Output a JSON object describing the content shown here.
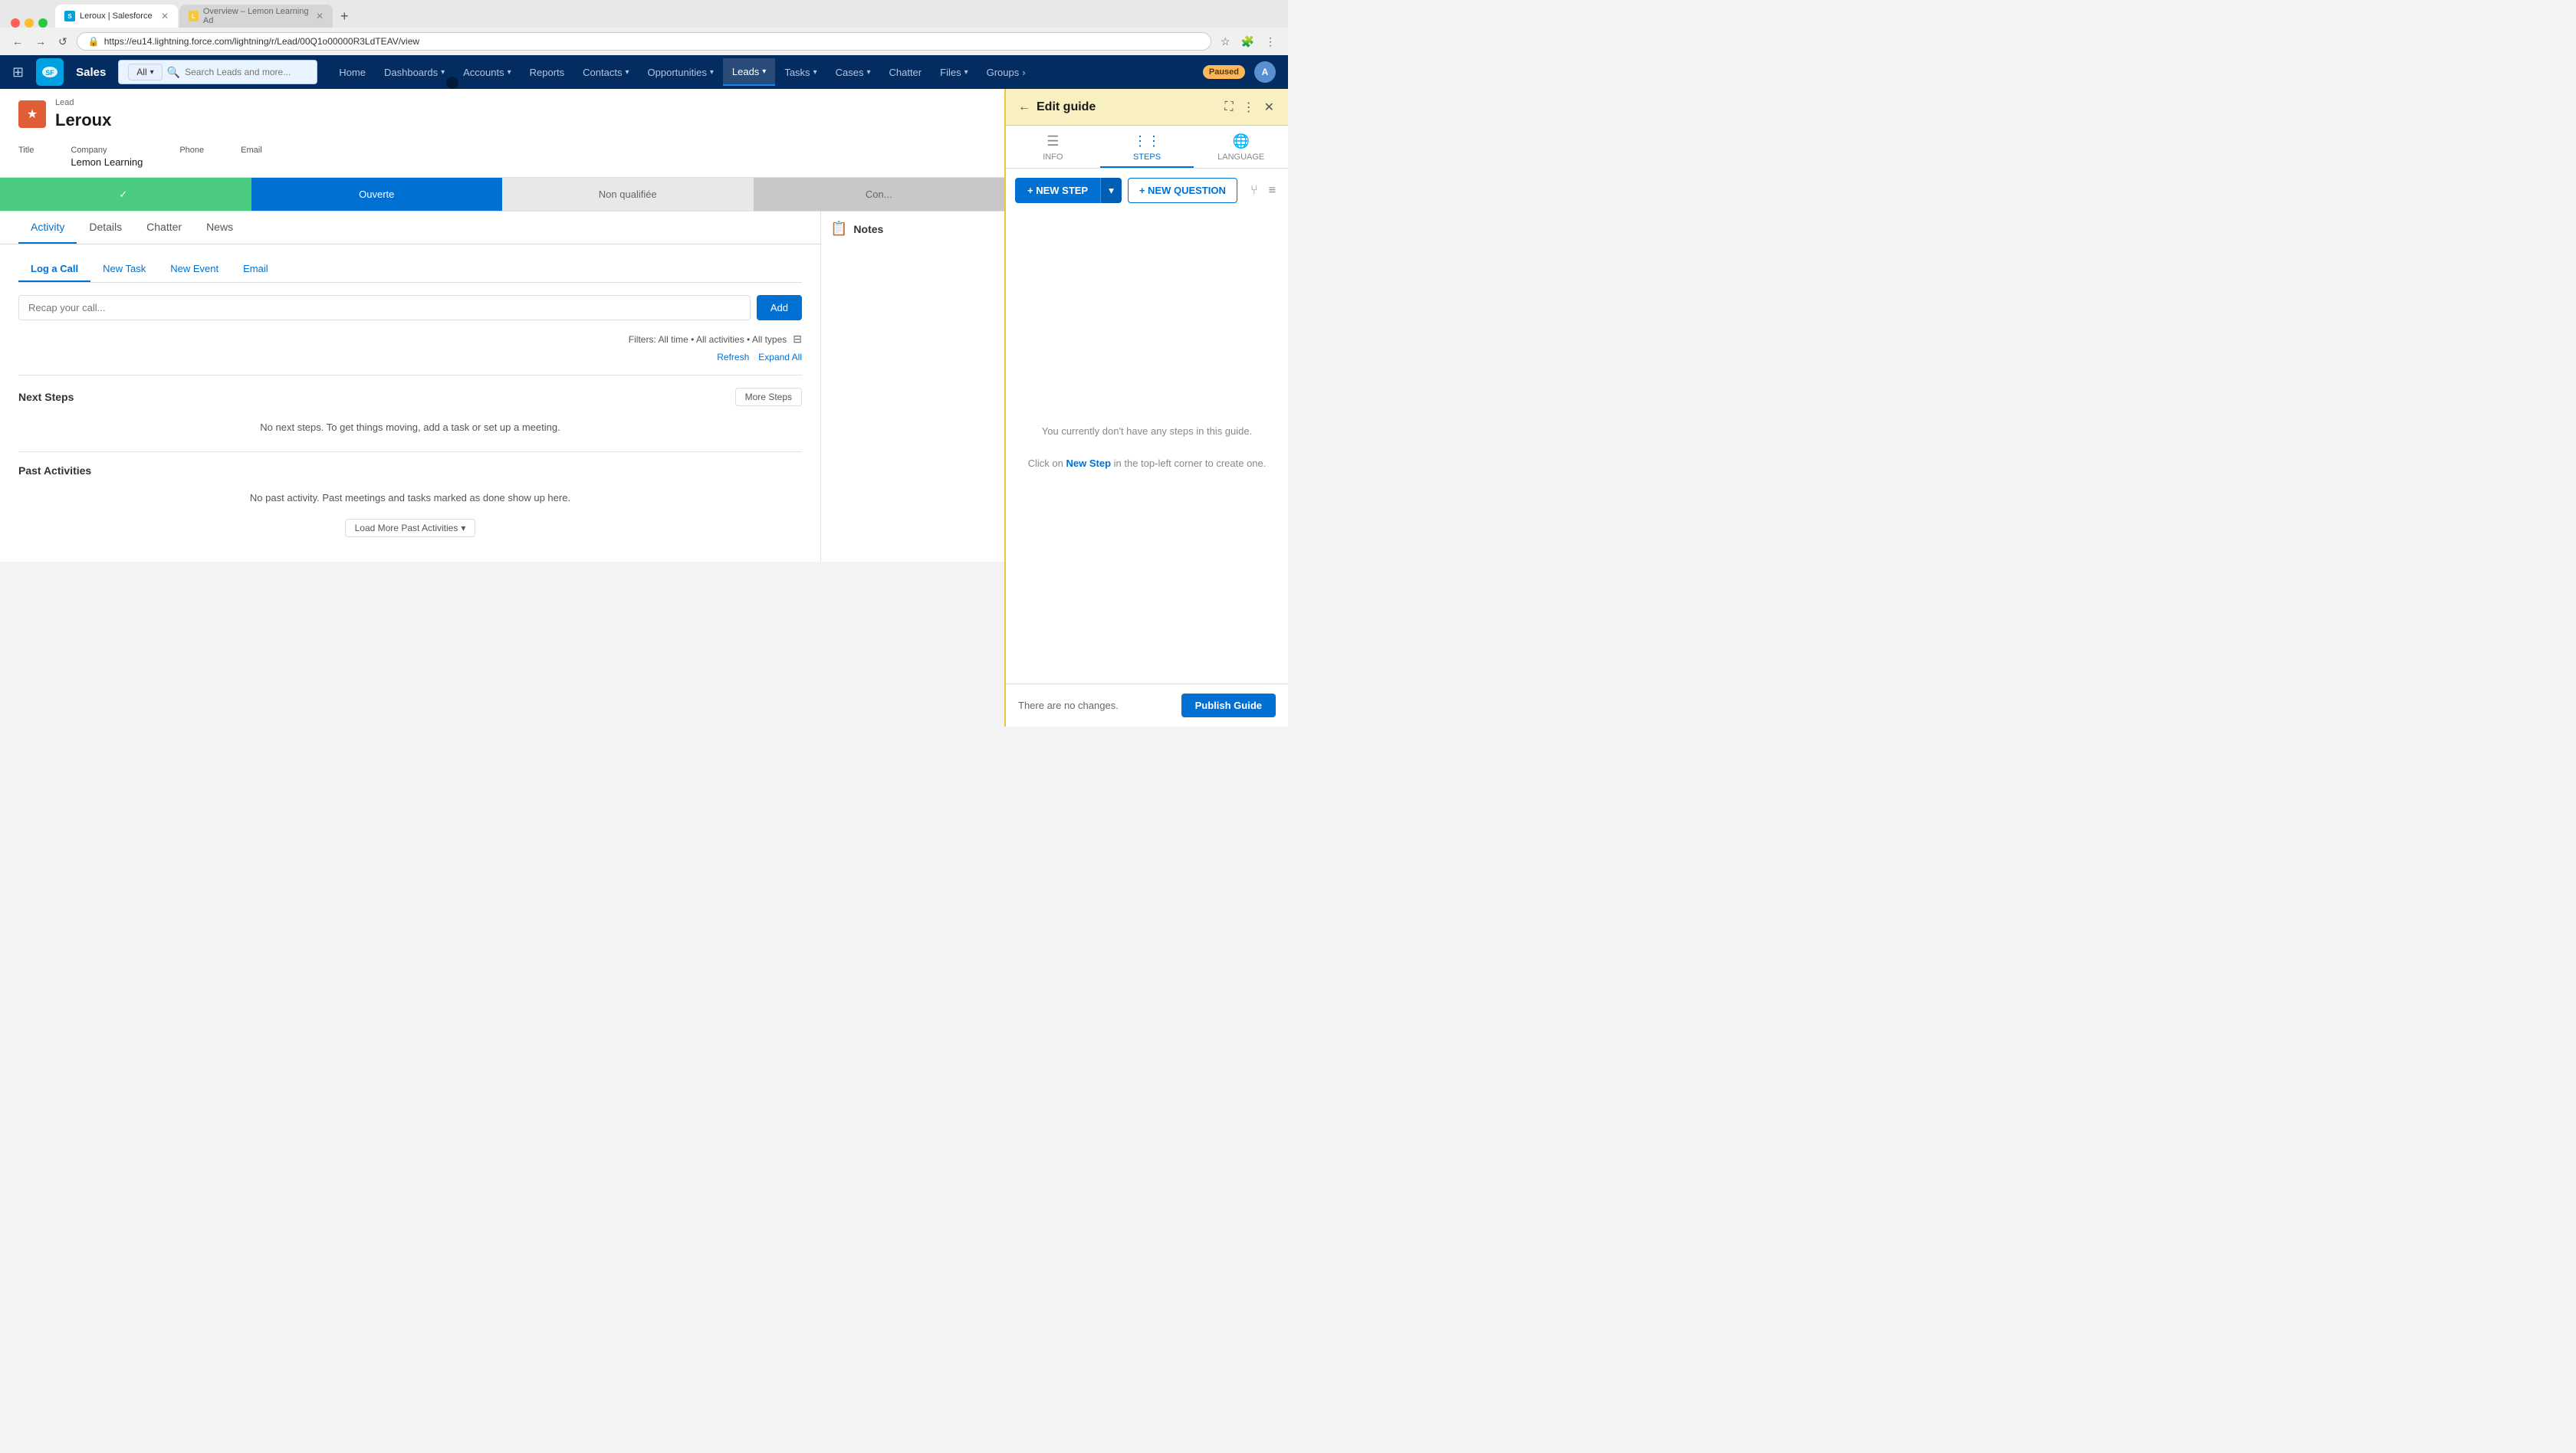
{
  "browser": {
    "tabs": [
      {
        "id": "tab1",
        "title": "Leroux | Salesforce",
        "url": "https://eu14.lightning.force.com/lightning/r/Lead/00Q1o00000R3LdTEAV/view",
        "active": true
      },
      {
        "id": "tab2",
        "title": "Overview – Lemon Learning Ad",
        "active": false
      }
    ],
    "url": "https://eu14.lightning.force.com/lightning/r/Lead/00Q1o00000R3LdTEAV/view",
    "search_filter": "All",
    "search_placeholder": "Search Leads and more..."
  },
  "salesforce": {
    "logo": "S",
    "app_name": "Sales",
    "nav_items": [
      {
        "label": "Home",
        "active": false
      },
      {
        "label": "Dashboards",
        "active": false,
        "has_dropdown": true
      },
      {
        "label": "Accounts",
        "active": false,
        "has_dropdown": true
      },
      {
        "label": "Reports",
        "active": false,
        "has_dropdown": false
      },
      {
        "label": "Contacts",
        "active": false,
        "has_dropdown": true
      },
      {
        "label": "Opportunities",
        "active": false,
        "has_dropdown": true
      },
      {
        "label": "Leads",
        "active": true,
        "has_dropdown": true
      },
      {
        "label": "Tasks",
        "active": false,
        "has_dropdown": true
      },
      {
        "label": "Cases",
        "active": false,
        "has_dropdown": true
      },
      {
        "label": "Chatter",
        "active": false
      },
      {
        "label": "Files",
        "active": false,
        "has_dropdown": true
      },
      {
        "label": "Groups",
        "active": false,
        "has_dropdown": false
      }
    ],
    "paused_label": "Paused",
    "user_avatar": "A"
  },
  "lead": {
    "type_label": "Lead",
    "name": "Leroux",
    "fields": [
      {
        "label": "Title",
        "value": ""
      },
      {
        "label": "Company",
        "value": "Lemon Learning"
      },
      {
        "label": "Phone",
        "value": ""
      },
      {
        "label": "Email",
        "value": ""
      }
    ],
    "stages": [
      {
        "label": "✓",
        "status": "completed"
      },
      {
        "label": "Ouverte",
        "status": "active"
      },
      {
        "label": "Non qualifiée",
        "status": "inactive"
      },
      {
        "label": "Con...",
        "status": "last-inactive"
      }
    ]
  },
  "content": {
    "tabs": [
      "Activity",
      "Details",
      "Chatter",
      "News"
    ],
    "active_tab": "Activity",
    "activity": {
      "subtabs": [
        "Log a Call",
        "New Task",
        "New Event",
        "Email"
      ],
      "active_subtab": "Log a Call",
      "recap_placeholder": "Recap your call...",
      "add_label": "Add",
      "filters_text": "Filters: All time • All activities • All types",
      "refresh_label": "Refresh",
      "expand_all_label": "Expand All",
      "next_steps": {
        "title": "Next Steps",
        "more_steps_label": "More Steps",
        "empty_message": "No next steps. To get things moving, add a task or set up a meeting."
      },
      "past_activities": {
        "title": "Past Activities",
        "empty_message": "No past activity. Past meetings and tasks marked as done show up here.",
        "load_more_label": "Load More Past Activities"
      }
    },
    "notes": {
      "title": "Notes",
      "icon": "📋"
    }
  },
  "edit_guide": {
    "title": "Edit guide",
    "back_label": "←",
    "tabs": [
      {
        "id": "info",
        "label": "INFO",
        "icon": "☰"
      },
      {
        "id": "steps",
        "label": "STEPS",
        "icon": "⋮⋮",
        "active": true
      },
      {
        "id": "language",
        "label": "LANGUAGE",
        "icon": "🌐"
      }
    ],
    "new_step_label": "+ NEW STEP",
    "new_question_label": "+ NEW QUESTION",
    "empty_message_line1": "You currently don't have any steps in this guide.",
    "empty_message_line2": "Click on",
    "empty_message_highlight": "New Step",
    "empty_message_line3": "in the top-left corner to create one.",
    "bottom": {
      "no_changes_text": "There are no changes.",
      "publish_label": "Publish Guide"
    }
  }
}
